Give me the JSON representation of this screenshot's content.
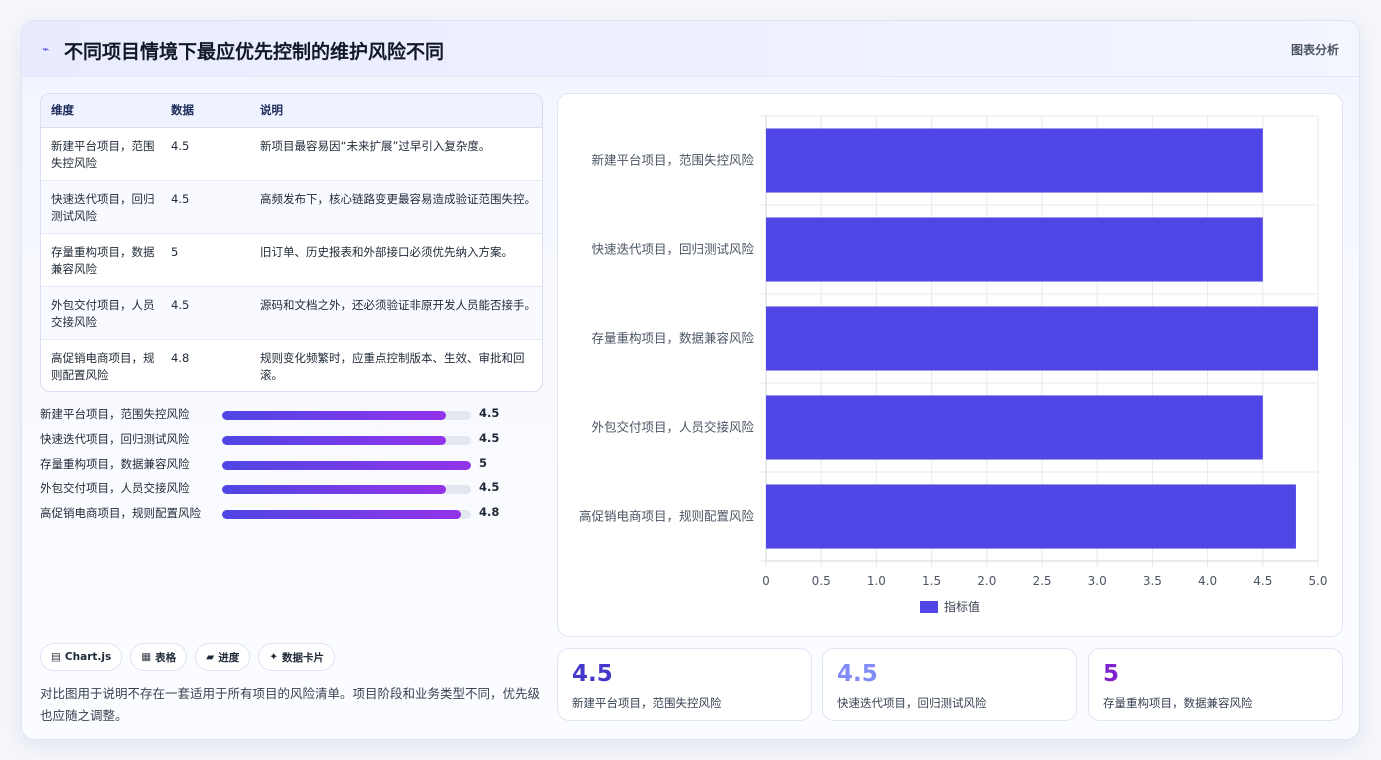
{
  "header": {
    "title": "不同项目情境下最应优先控制的维护风险不同",
    "right_label": "图表分析"
  },
  "table": {
    "headers": [
      "维度",
      "数据",
      "说明"
    ],
    "rows": [
      {
        "dim": "新建平台项目，范围失控风险",
        "value": "4.5",
        "desc": "新项目最容易因“未来扩展”过早引入复杂度。"
      },
      {
        "dim": "快速迭代项目，回归测试风险",
        "value": "4.5",
        "desc": "高频发布下，核心链路变更最容易造成验证范围失控。"
      },
      {
        "dim": "存量重构项目，数据兼容风险",
        "value": "5",
        "desc": "旧订单、历史报表和外部接口必须优先纳入方案。"
      },
      {
        "dim": "外包交付项目，人员交接风险",
        "value": "4.5",
        "desc": "源码和文档之外，还必须验证非原开发人员能否接手。"
      },
      {
        "dim": "高促销电商项目，规则配置风险",
        "value": "4.8",
        "desc": "规则变化频繁时，应重点控制版本、生效、审批和回滚。"
      }
    ]
  },
  "progress": {
    "max": 5,
    "items": [
      {
        "label": "新建平台项目，范围失控风险",
        "value": 4.5,
        "text": "4.5"
      },
      {
        "label": "快速迭代项目，回归测试风险",
        "value": 4.5,
        "text": "4.5"
      },
      {
        "label": "存量重构项目，数据兼容风险",
        "value": 5,
        "text": "5"
      },
      {
        "label": "外包交付项目，人员交接风险",
        "value": 4.5,
        "text": "4.5"
      },
      {
        "label": "高促销电商项目，规则配置风险",
        "value": 4.8,
        "text": "4.8"
      }
    ]
  },
  "tags": [
    {
      "icon": "▤",
      "label": "Chart.js"
    },
    {
      "icon": "▦",
      "label": "表格"
    },
    {
      "icon": "▰",
      "label": "进度"
    },
    {
      "icon": "✦",
      "label": "数据卡片"
    }
  ],
  "note": "对比图用于说明不存在一套适用于所有项目的风险清单。项目阶段和业务类型不同，优先级也应随之调整。",
  "stats": [
    {
      "value": "4.5",
      "label": "新建平台项目，范围失控风险",
      "color": "#4338ca"
    },
    {
      "value": "4.5",
      "label": "快速迭代项目，回归测试风险",
      "color": "#818cf8"
    },
    {
      "value": "5",
      "label": "存量重构项目，数据兼容风险",
      "color": "#7e22ce"
    }
  ],
  "chart_data": {
    "type": "bar",
    "orientation": "horizontal",
    "categories": [
      "新建平台项目，范围失控风险",
      "快速迭代项目，回归测试风险",
      "存量重构项目，数据兼容风险",
      "外包交付项目，人员交接风险",
      "高促销电商项目，规则配置风险"
    ],
    "series": [
      {
        "name": "指标值",
        "values": [
          4.5,
          4.5,
          5,
          4.5,
          4.8
        ]
      }
    ],
    "xlim": [
      0,
      5
    ],
    "xticks": [
      "0",
      "0.5",
      "1.0",
      "1.5",
      "2.0",
      "2.5",
      "3.0",
      "3.5",
      "4.0",
      "4.5",
      "5.0"
    ],
    "grid": true,
    "legend": "bottom",
    "bar_color": "#4f46e5"
  }
}
